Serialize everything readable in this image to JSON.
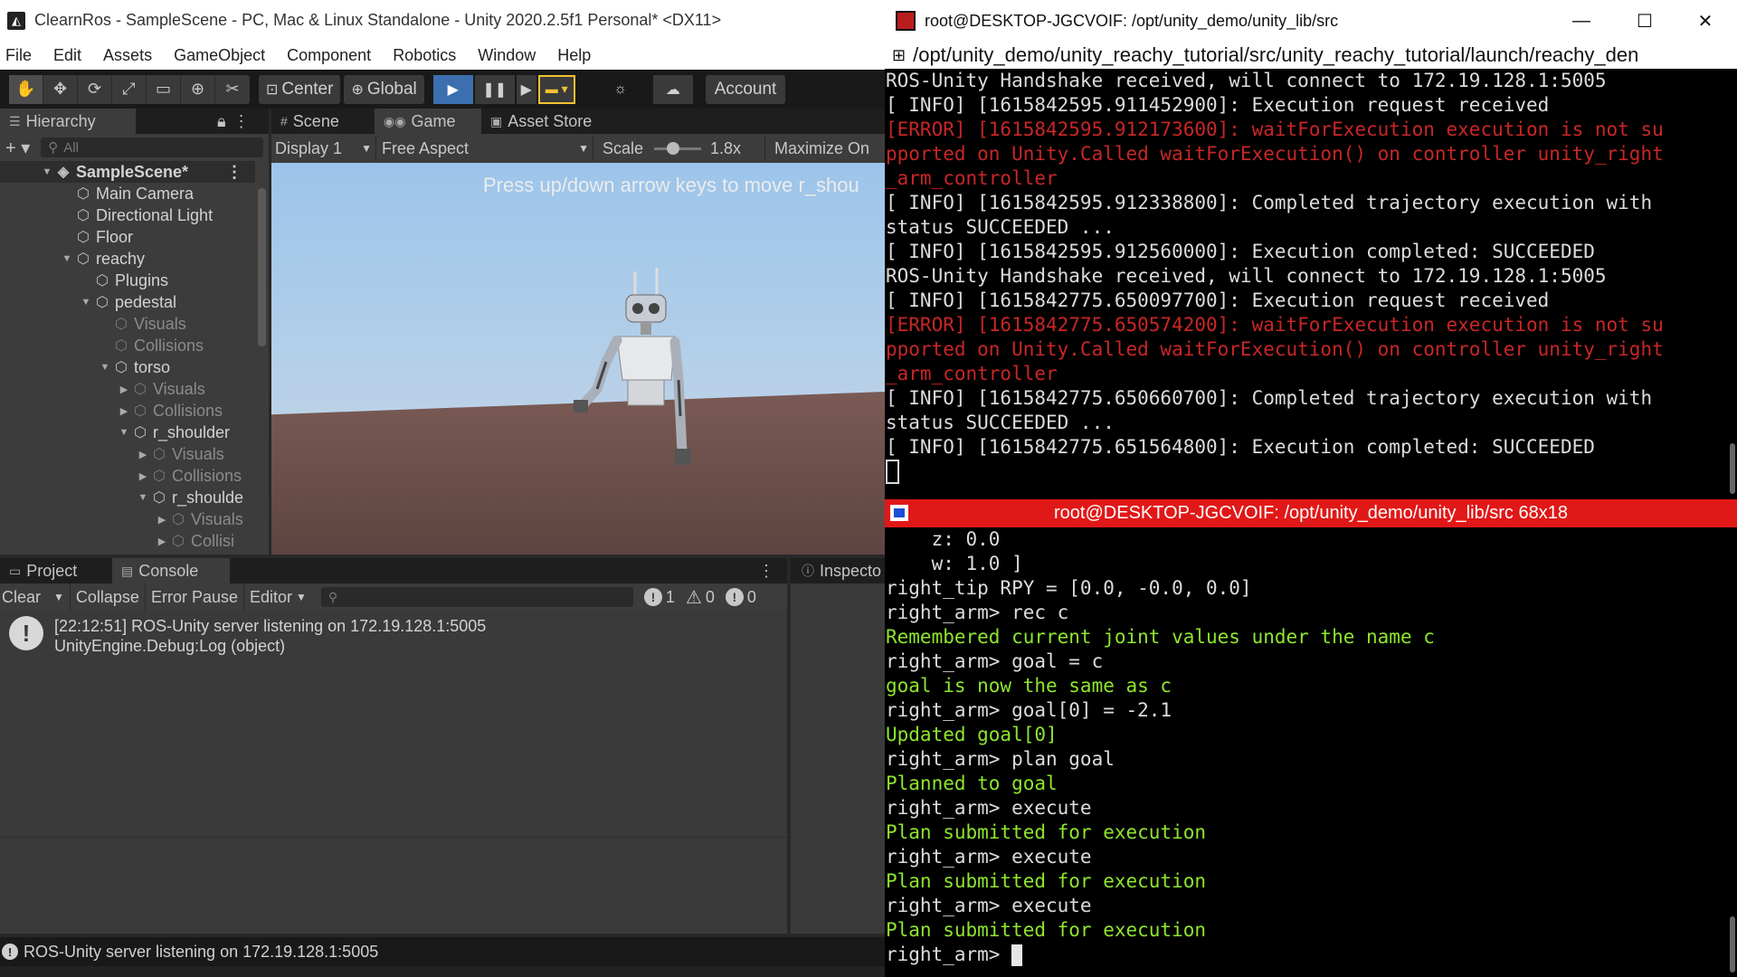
{
  "unity": {
    "title": "ClearnRos - SampleScene - PC, Mac & Linux Standalone - Unity 2020.2.5f1 Personal* <DX11>",
    "menu": [
      "File",
      "Edit",
      "Assets",
      "GameObject",
      "Component",
      "Robotics",
      "Window",
      "Help"
    ],
    "toolbar": {
      "pivot_center": "Center",
      "pivot_global": "Global",
      "account": "Account"
    },
    "hierarchy": {
      "tab": "Hierarchy",
      "search_placeholder": "All",
      "items": [
        {
          "label": "SampleScene*",
          "depth": 0,
          "expanded": true,
          "scene": true
        },
        {
          "label": "Main Camera",
          "depth": 1
        },
        {
          "label": "Directional Light",
          "depth": 1
        },
        {
          "label": "Floor",
          "depth": 1
        },
        {
          "label": "reachy",
          "depth": 1,
          "expanded": true
        },
        {
          "label": "Plugins",
          "depth": 2
        },
        {
          "label": "pedestal",
          "depth": 2,
          "expanded": true
        },
        {
          "label": "Visuals",
          "depth": 3,
          "dim": true
        },
        {
          "label": "Collisions",
          "depth": 3,
          "dim": true
        },
        {
          "label": "torso",
          "depth": 3,
          "expanded": true
        },
        {
          "label": "Visuals",
          "depth": 4,
          "dim": true,
          "collapsed": true
        },
        {
          "label": "Collisions",
          "depth": 4,
          "dim": true,
          "collapsed": true
        },
        {
          "label": "r_shoulder",
          "depth": 4,
          "expanded": true
        },
        {
          "label": "Visuals",
          "depth": 5,
          "dim": true,
          "collapsed": true
        },
        {
          "label": "Collisions",
          "depth": 5,
          "dim": true,
          "collapsed": true
        },
        {
          "label": "r_shoulde",
          "depth": 5,
          "expanded": true
        },
        {
          "label": "Visuals",
          "depth": 6,
          "dim": true,
          "collapsed": true
        },
        {
          "label": "Collisi",
          "depth": 6,
          "dim": true,
          "collapsed": true
        }
      ]
    },
    "game": {
      "tabs": [
        "Scene",
        "Game",
        "Asset Store"
      ],
      "display": "Display 1",
      "aspect": "Free Aspect",
      "scale_label": "Scale",
      "scale_value": "1.8x",
      "maximize": "Maximize On",
      "hint": "Press up/down arrow keys to move r_shou"
    },
    "console": {
      "tabs": [
        "Project",
        "Console"
      ],
      "clear": "Clear",
      "collapse": "Collapse",
      "error_pause": "Error Pause",
      "editor": "Editor",
      "count_info": "1",
      "count_warn": "0",
      "count_error": "0",
      "log_line1": "[22:12:51] ROS-Unity server listening on 172.19.128.1:5005",
      "log_line2": "UnityEngine.Debug:Log (object)"
    },
    "inspector_tab": "Inspecto",
    "status": "ROS-Unity server listening on 172.19.128.1:5005"
  },
  "terminal": {
    "title": "root@DESKTOP-JGCVOIF: /opt/unity_demo/unity_lib/src",
    "path": "/opt/unity_demo/unity_reachy_tutorial/src/unity_reachy_tutorial/launch/reachy_den",
    "top_lines": [
      {
        "t": "ROS-Unity Handshake received, will connect to 172.19.128.1:5005",
        "c": ""
      },
      {
        "t": "[ INFO] [1615842595.911452900]: Execution request received",
        "c": ""
      },
      {
        "t": "[ERROR] [1615842595.912173600]: waitForExecution execution is not su",
        "c": "err"
      },
      {
        "t": "pported on Unity.Called waitForExecution() on controller unity_right",
        "c": "err"
      },
      {
        "t": "_arm_controller",
        "c": "err"
      },
      {
        "t": "[ INFO] [1615842595.912338800]: Completed trajectory execution with",
        "c": ""
      },
      {
        "t": "status SUCCEEDED ...",
        "c": ""
      },
      {
        "t": "[ INFO] [1615842595.912560000]: Execution completed: SUCCEEDED",
        "c": ""
      },
      {
        "t": "ROS-Unity Handshake received, will connect to 172.19.128.1:5005",
        "c": ""
      },
      {
        "t": "[ INFO] [1615842775.650097700]: Execution request received",
        "c": ""
      },
      {
        "t": "[ERROR] [1615842775.650574200]: waitForExecution execution is not su",
        "c": "err"
      },
      {
        "t": "pported on Unity.Called waitForExecution() on controller unity_right",
        "c": "err"
      },
      {
        "t": "_arm_controller",
        "c": "err"
      },
      {
        "t": "[ INFO] [1615842775.650660700]: Completed trajectory execution with",
        "c": ""
      },
      {
        "t": "status SUCCEEDED ...",
        "c": ""
      },
      {
        "t": "[ INFO] [1615842775.651564800]: Execution completed: SUCCEEDED",
        "c": ""
      }
    ],
    "split_title": "root@DESKTOP-JGCVOIF: /opt/unity_demo/unity_lib/src 68x18",
    "bottom_lines": [
      {
        "t": "    z: 0.0",
        "c": ""
      },
      {
        "t": "    w: 1.0 ]",
        "c": ""
      },
      {
        "t": "right_tip RPY = [0.0, -0.0, 0.0]",
        "c": ""
      },
      {
        "t": "right_arm> rec c",
        "c": ""
      },
      {
        "t": "Remembered current joint values under the name c",
        "c": "ok"
      },
      {
        "t": "right_arm> goal = c",
        "c": ""
      },
      {
        "t": "goal is now the same as c",
        "c": "ok"
      },
      {
        "t": "right_arm> goal[0] = -2.1",
        "c": ""
      },
      {
        "t": "Updated goal[0]",
        "c": "ok"
      },
      {
        "t": "right_arm> plan goal",
        "c": ""
      },
      {
        "t": "Planned to goal",
        "c": "ok"
      },
      {
        "t": "right_arm> execute",
        "c": ""
      },
      {
        "t": "Plan submitted for execution",
        "c": "ok"
      },
      {
        "t": "right_arm> execute",
        "c": ""
      },
      {
        "t": "Plan submitted for execution",
        "c": "ok"
      },
      {
        "t": "right_arm> execute",
        "c": ""
      },
      {
        "t": "Plan submitted for execution",
        "c": "ok"
      }
    ],
    "prompt": "right_arm> "
  }
}
